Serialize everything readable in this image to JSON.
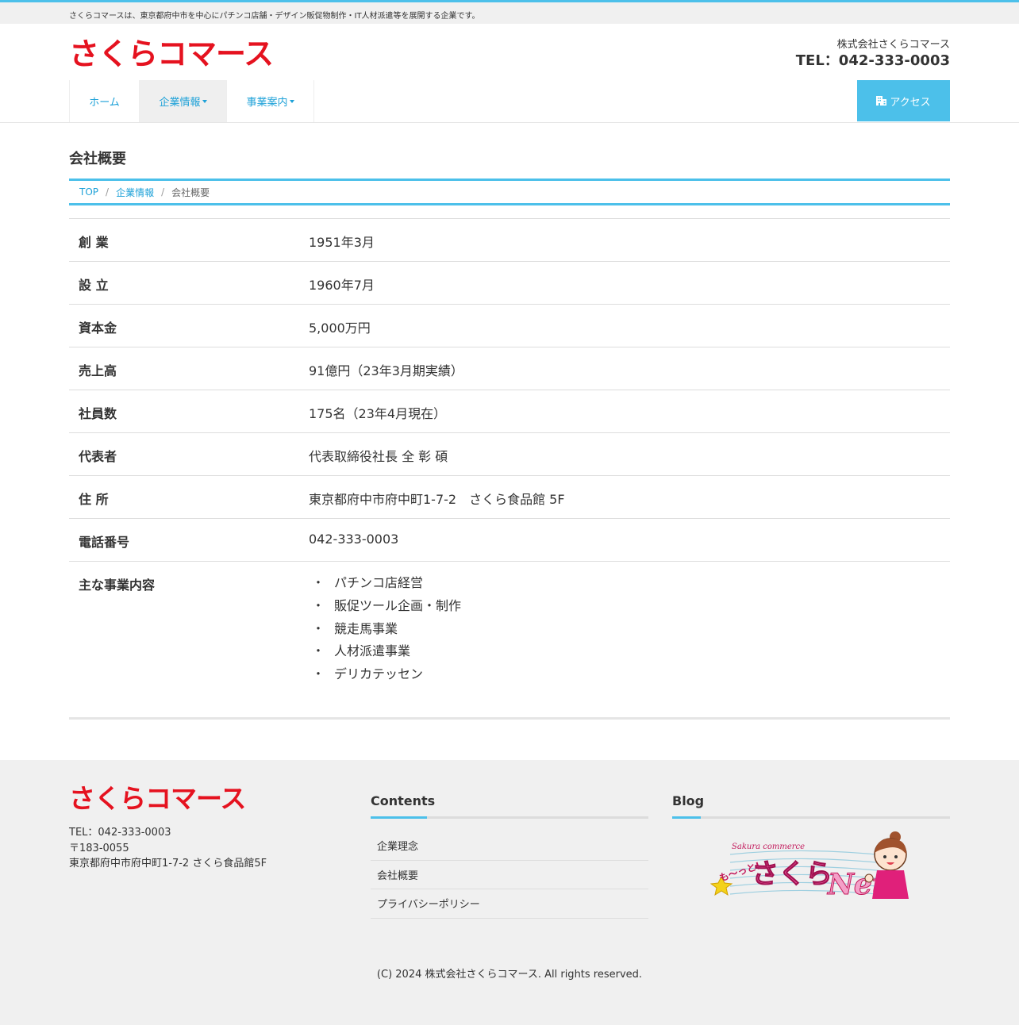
{
  "topbar": {
    "tagline": "さくらコマースは、東京都府中市を中心にパチンコ店舗・デザイン販促物制作・IT人材派遣等を展開する企業です。"
  },
  "header": {
    "logo": "さくらコマース",
    "company_name": "株式会社さくらコマース",
    "tel": "TEL：042-333-0003"
  },
  "nav": {
    "items": [
      {
        "label": "ホーム"
      },
      {
        "label": "企業情報"
      },
      {
        "label": "事業案内"
      }
    ],
    "access_label": "アクセス"
  },
  "page": {
    "title": "会社概要",
    "breadcrumb": [
      "TOP",
      "企業情報",
      "会社概要"
    ]
  },
  "company_info": [
    {
      "label": "創 業",
      "value": "1951年3月"
    },
    {
      "label": "設 立",
      "value": "1960年7月"
    },
    {
      "label": "資本金",
      "value": "5,000万円"
    },
    {
      "label": "売上高",
      "value": "91億円（23年3月期実績）"
    },
    {
      "label": "社員数",
      "value": "175名（23年4月現在）"
    },
    {
      "label": "代表者",
      "value": "代表取締役社長 全 彰 碩"
    },
    {
      "label": "住 所",
      "value": "東京都府中市府中町1-7-2　さくら食品館 5F"
    },
    {
      "label": "電話番号",
      "value": "042-333-0003"
    }
  ],
  "business": {
    "label": "主な事業内容",
    "bullet": "・",
    "items": [
      "パチンコ店経営",
      "販促ツール企画・制作",
      "競走馬事業",
      "人材派遣事業",
      "デリカテッセン"
    ]
  },
  "footer": {
    "logo": "さくらコマース",
    "tel": "TEL：042-333-0003",
    "zip": "〒183-0055",
    "address": "東京都府中市府中町1-7-2 さくら食品館5F",
    "contents_heading": "Contents",
    "contents_links": [
      "企業理念",
      "会社概要",
      "プライバシーポリシー"
    ],
    "blog_heading": "Blog",
    "blog_banner": {
      "brand": "Sakura commerce",
      "prefix": "も〜っと!",
      "title": "さくら",
      "suffix": "Net"
    },
    "copyright": "(C) 2024 株式会社さくらコマース. All rights reserved."
  }
}
